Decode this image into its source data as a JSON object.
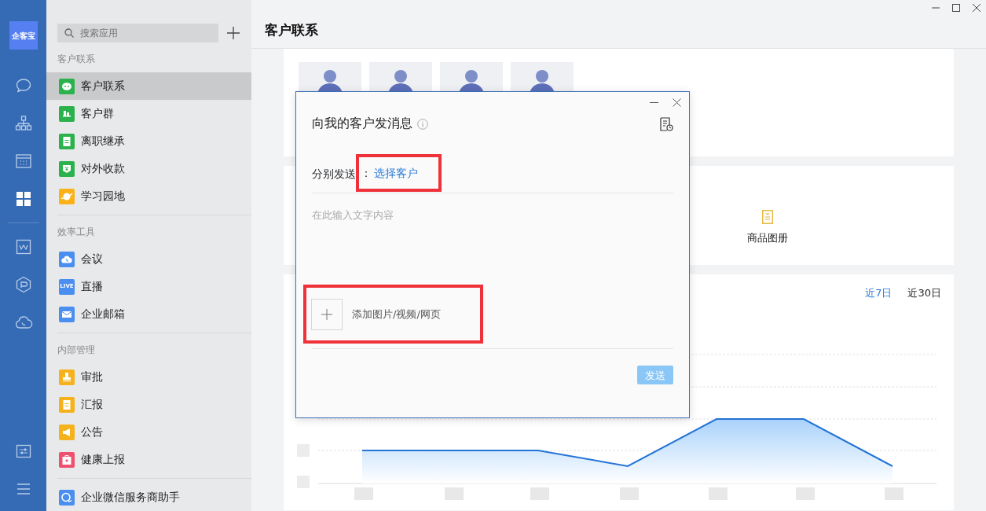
{
  "rail": {
    "logo": "企客宝",
    "top": [
      {
        "kind": "chat",
        "selected": false
      },
      {
        "kind": "org",
        "selected": false
      },
      {
        "kind": "calendar",
        "selected": false
      },
      {
        "kind": "apps",
        "selected": true
      }
    ],
    "middle": [
      {
        "kind": "doc",
        "selected": false
      },
      {
        "kind": "cube",
        "selected": false
      },
      {
        "kind": "cloud",
        "selected": false
      }
    ],
    "bottom": [
      {
        "kind": "sliders",
        "selected": false
      },
      {
        "kind": "menu",
        "selected": false
      }
    ]
  },
  "sidebar": {
    "search": {
      "placeholder": "搜索应用"
    },
    "sections": [
      {
        "title": "客户联系",
        "items": [
          {
            "label": "客户联系",
            "kind": "chat",
            "color": "#2bb24c",
            "selected": true
          },
          {
            "label": "客户群",
            "kind": "group",
            "color": "#2bb24c",
            "selected": false
          },
          {
            "label": "离职继承",
            "kind": "doc",
            "color": "#2bb24c",
            "selected": false
          },
          {
            "label": "对外收款",
            "kind": "money",
            "color": "#2bb24c",
            "selected": false
          },
          {
            "label": "学习园地",
            "kind": "planet",
            "color": "#fbb218",
            "selected": false
          }
        ]
      },
      {
        "title": "效率工具",
        "items": [
          {
            "label": "会议",
            "kind": "cloud",
            "color": "#4a8ff0",
            "selected": false
          },
          {
            "label": "直播",
            "kind": "badge",
            "badge": "LIVE",
            "color": "#4a8ff0",
            "selected": false
          },
          {
            "label": "企业邮箱",
            "kind": "mail",
            "color": "#4a8ff0",
            "selected": false
          }
        ]
      },
      {
        "title": "内部管理",
        "items": [
          {
            "label": "审批",
            "kind": "stamp",
            "color": "#f5b21d",
            "selected": false
          },
          {
            "label": "汇报",
            "kind": "doc",
            "color": "#f5b21d",
            "selected": false
          },
          {
            "label": "公告",
            "kind": "horn",
            "color": "#f5b21d",
            "selected": false
          },
          {
            "label": "健康上报",
            "kind": "kit",
            "color": "#f0506e",
            "selected": false
          }
        ]
      },
      {
        "items": [
          {
            "label": "企业微信服务商助手",
            "kind": "bubbles",
            "color": "#4a8ff0",
            "selected": false
          }
        ]
      }
    ]
  },
  "main": {
    "title": "客户联系",
    "tools": [
      {
        "label": "商品图册"
      }
    ],
    "range_tabs": [
      {
        "label": "近7日",
        "selected": true
      },
      {
        "label": "近30日",
        "selected": false
      }
    ]
  },
  "dialog": {
    "title": "向我的客户发消息",
    "recipient": {
      "label": "分别发送",
      "colon": "：",
      "link": "选择客户",
      "highlighted": true
    },
    "message": {
      "placeholder": "在此输入文字内容"
    },
    "attachment": {
      "label": "添加图片/视频/网页",
      "highlighted": true
    },
    "send_button": {
      "label": "发送",
      "disabled": true
    }
  }
}
